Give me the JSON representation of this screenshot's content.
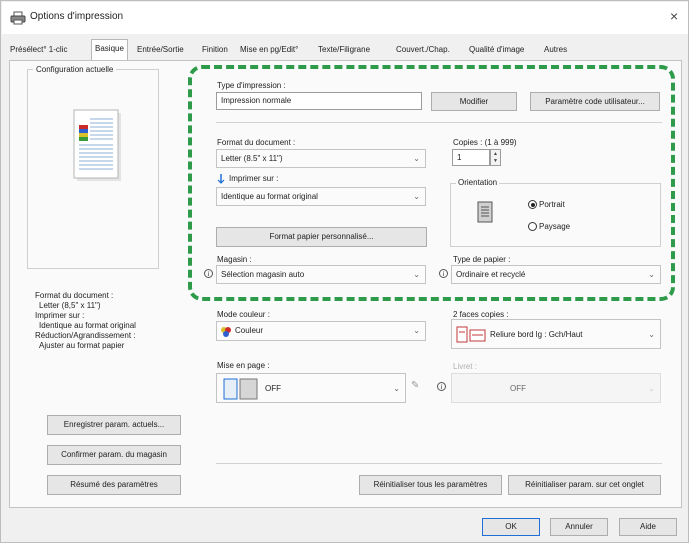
{
  "window": {
    "title": "Options d'impression",
    "close_label": "×"
  },
  "tabs": [
    {
      "label": "Présélect° 1-clic"
    },
    {
      "label": "Basique"
    },
    {
      "label": "Entrée/Sortie"
    },
    {
      "label": "Finition"
    },
    {
      "label": "Mise en pg/Edit°"
    },
    {
      "label": "Texte/Filigrane"
    },
    {
      "label": "Couvert./Chap."
    },
    {
      "label": "Qualité d'image"
    },
    {
      "label": "Autres"
    }
  ],
  "left": {
    "config_title": "Configuration actuelle",
    "summary": [
      "Format du document :",
      "Letter (8,5\" x 11\")",
      "Imprimer sur :",
      "Identique au format original",
      "Réduction/Agrandissement :",
      "Ajuster au format papier"
    ],
    "buttons": {
      "save": "Enregistrer param. actuels...",
      "confirm": "Confirmer param. du magasin",
      "summary": "Résumé des paramètres"
    }
  },
  "main": {
    "print_type": {
      "label": "Type d'impression :",
      "value": "Impression normale",
      "modify": "Modifier",
      "user_code": "Paramètre code utilisateur..."
    },
    "doc_format": {
      "label": "Format du document :",
      "value": "Letter (8.5\" x 11\")"
    },
    "copies": {
      "label": "Copies : (1 à 999)",
      "value": "1"
    },
    "print_on": {
      "label": "Imprimer sur :",
      "value": "Identique au format original"
    },
    "orientation": {
      "label": "Orientation",
      "portrait": "Portrait",
      "landscape": "Paysage",
      "selected": "Portrait"
    },
    "custom_paper": "Format papier personnalisé...",
    "tray": {
      "label": "Magasin :",
      "value": "Sélection magasin auto"
    },
    "paper_type": {
      "label": "Type de papier :",
      "value": "Ordinaire et recyclé"
    },
    "color_mode": {
      "label": "Mode couleur :",
      "value": "Couleur"
    },
    "duplex": {
      "label": "2 faces copies :",
      "value": "Reliure bord lg : Gch/Haut"
    },
    "layout": {
      "label": "Mise en page :",
      "value": "OFF"
    },
    "booklet": {
      "label": "Livret :",
      "value": "OFF"
    }
  },
  "footer": {
    "reset_all": "Réinitialiser tous les paramètres",
    "reset_tab": "Réinitialiser param. sur cet onglet",
    "ok": "OK",
    "cancel": "Annuler",
    "help": "Aide"
  },
  "colors": {
    "highlight_dash": "#2e9b4a",
    "accent": "#1f6fd6"
  }
}
